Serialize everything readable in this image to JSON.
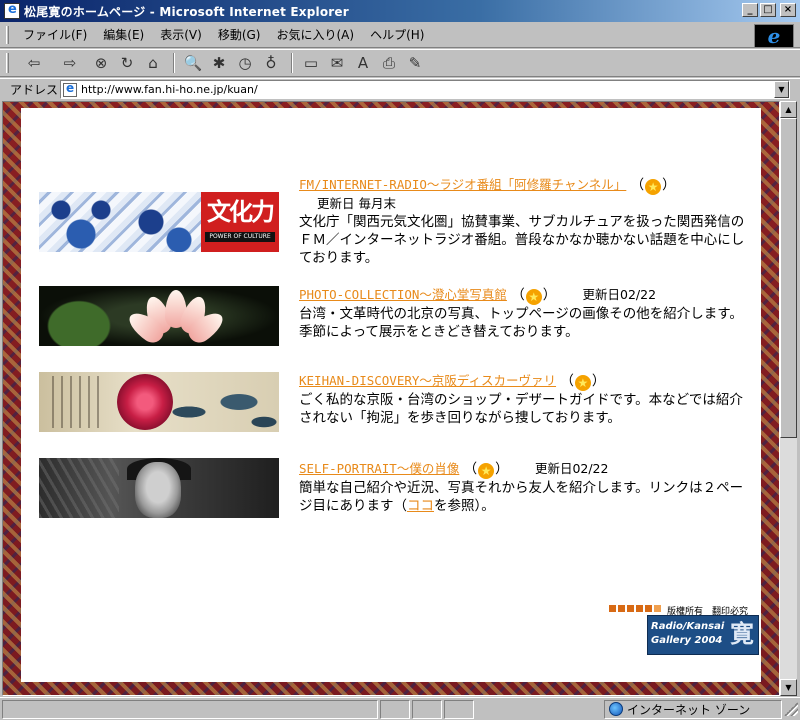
{
  "window": {
    "title": "松尾寛のホームページ - Microsoft Internet Explorer",
    "btn_min": "_",
    "btn_max": "□",
    "btn_close": "×"
  },
  "menu": [
    "ファイル(F)",
    "編集(E)",
    "表示(V)",
    "移動(G)",
    "お気に入り(A)",
    "ヘルプ(H)"
  ],
  "toolbar": {
    "back": "⇦",
    "forward": "⇨",
    "stop": "⊗",
    "refresh": "↻",
    "home": "⌂",
    "search": "🔍",
    "favorites": "✱",
    "history": "◷",
    "channels": "♁",
    "fullscreen": "▭",
    "mail": "✉",
    "font": "A",
    "print": "⎙",
    "edit": "✎"
  },
  "address": {
    "label": "アドレス",
    "url": "http://www.fan.hi-ho.ne.jp/kuan/"
  },
  "entries": [
    {
      "link": "FM/INTERNET-RADIO～ラジオ番組「阿修羅チャンネル」",
      "updated": "更新日 毎月末",
      "description": "文化庁「関西元気文化圏」協賛事業、サブカルチュアを扱った関西発信のＦＭ／インターネットラジオ番組。普段なかなか聴かない話題を中心にしております。",
      "banner_title": "文化力",
      "banner_sub": "POWER OF CULTURE"
    },
    {
      "link": "PHOTO-COLLECTION～澄心堂写真館",
      "updated": "更新日02/22",
      "description": "台湾・文革時代の北京の写真、トップページの画像その他を紹介します。季節によって展示をときどき替えております。"
    },
    {
      "link": "KEIHAN-DISCOVERY～京阪ディスカーヴァリ",
      "updated": "",
      "description": "ごく私的な京阪・台湾のショップ・デザートガイドです。本などでは紹介されない「拘泥」を歩き回りながら捜しております。"
    },
    {
      "link": "SELF-PORTRAIT～僕の肖像",
      "updated": "更新日02/22",
      "description_before": "簡単な自己紹介や近況、写真それから友人を紹介します。リンクは２ページ目にあります（",
      "description_link": "ココ",
      "description_after": "を参照）。"
    }
  ],
  "paren_open": "（",
  "paren_close": "）",
  "star": "★",
  "footer": {
    "copyright": "版權所有　翻印必究",
    "logo_line1": "Radio/Kansai",
    "logo_line2": "Gallery 2004",
    "logo_mark": "寛"
  },
  "status": {
    "zone": "インターネット ゾーン"
  },
  "colors": {
    "link": "#e88a1a",
    "star": "#f5a200",
    "logo_bg": "#1d4e86"
  }
}
